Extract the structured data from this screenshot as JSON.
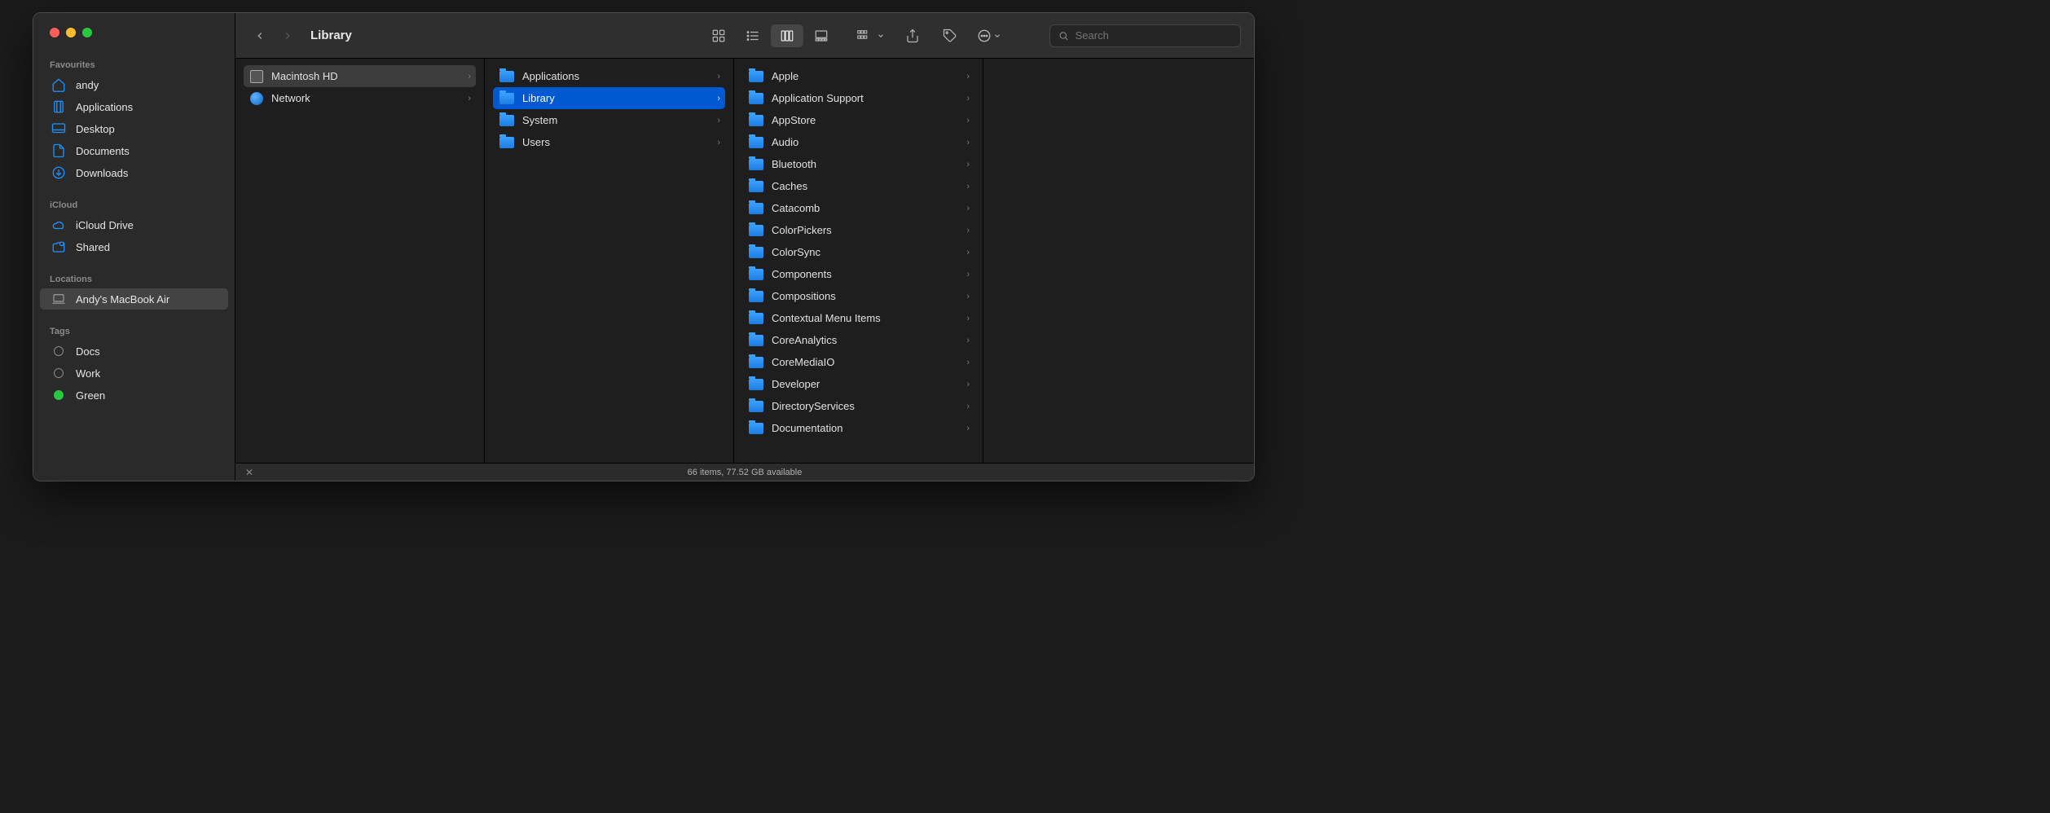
{
  "window": {
    "title": "Library"
  },
  "search": {
    "placeholder": "Search"
  },
  "sidebar": {
    "sections": [
      {
        "label": "Favourites",
        "items": [
          {
            "icon": "home-icon",
            "label": "andy"
          },
          {
            "icon": "app-icon",
            "label": "Applications"
          },
          {
            "icon": "desktop-icon",
            "label": "Desktop"
          },
          {
            "icon": "doc-icon",
            "label": "Documents"
          },
          {
            "icon": "download-icon",
            "label": "Downloads"
          }
        ]
      },
      {
        "label": "iCloud",
        "items": [
          {
            "icon": "cloud-icon",
            "label": "iCloud Drive"
          },
          {
            "icon": "shared-icon",
            "label": "Shared"
          }
        ]
      },
      {
        "label": "Locations",
        "items": [
          {
            "icon": "laptop-icon",
            "label": "Andy's MacBook Air",
            "selected": true
          }
        ]
      },
      {
        "label": "Tags",
        "items": [
          {
            "icon": "tagdot",
            "label": "Docs",
            "color": "#8a8a8a"
          },
          {
            "icon": "tagdot",
            "label": "Work",
            "color": "#8a8a8a"
          },
          {
            "icon": "tagdot",
            "label": "Green",
            "color": "#28c840"
          }
        ]
      }
    ]
  },
  "columns": [
    {
      "items": [
        {
          "kind": "hd",
          "label": "Macintosh HD",
          "sel": "grey",
          "arrow": true
        },
        {
          "kind": "net",
          "label": "Network",
          "arrow": true
        }
      ]
    },
    {
      "items": [
        {
          "kind": "folder",
          "label": "Applications",
          "arrow": true
        },
        {
          "kind": "folder",
          "label": "Library",
          "sel": "blue",
          "arrow": true
        },
        {
          "kind": "folder",
          "label": "System",
          "arrow": true
        },
        {
          "kind": "folder",
          "label": "Users",
          "arrow": true
        }
      ]
    },
    {
      "items": [
        {
          "kind": "folder",
          "label": "Apple",
          "arrow": true
        },
        {
          "kind": "folder",
          "label": "Application Support",
          "arrow": true
        },
        {
          "kind": "folder",
          "label": "AppStore",
          "arrow": true
        },
        {
          "kind": "folder",
          "label": "Audio",
          "arrow": true
        },
        {
          "kind": "folder",
          "label": "Bluetooth",
          "arrow": true
        },
        {
          "kind": "folder",
          "label": "Caches",
          "arrow": true
        },
        {
          "kind": "folder",
          "label": "Catacomb",
          "arrow": true
        },
        {
          "kind": "folder",
          "label": "ColorPickers",
          "arrow": true
        },
        {
          "kind": "folder",
          "label": "ColorSync",
          "arrow": true
        },
        {
          "kind": "folder",
          "label": "Components",
          "arrow": true
        },
        {
          "kind": "folder",
          "label": "Compositions",
          "arrow": true
        },
        {
          "kind": "folder",
          "label": "Contextual Menu Items",
          "arrow": true
        },
        {
          "kind": "folder",
          "label": "CoreAnalytics",
          "arrow": true
        },
        {
          "kind": "folder",
          "label": "CoreMediaIO",
          "arrow": true
        },
        {
          "kind": "folder",
          "label": "Developer",
          "arrow": true
        },
        {
          "kind": "folder",
          "label": "DirectoryServices",
          "arrow": true
        },
        {
          "kind": "folder",
          "label": "Documentation",
          "arrow": true
        }
      ]
    },
    {
      "items": []
    }
  ],
  "status": {
    "text": "66 items, 77.52 GB available"
  }
}
